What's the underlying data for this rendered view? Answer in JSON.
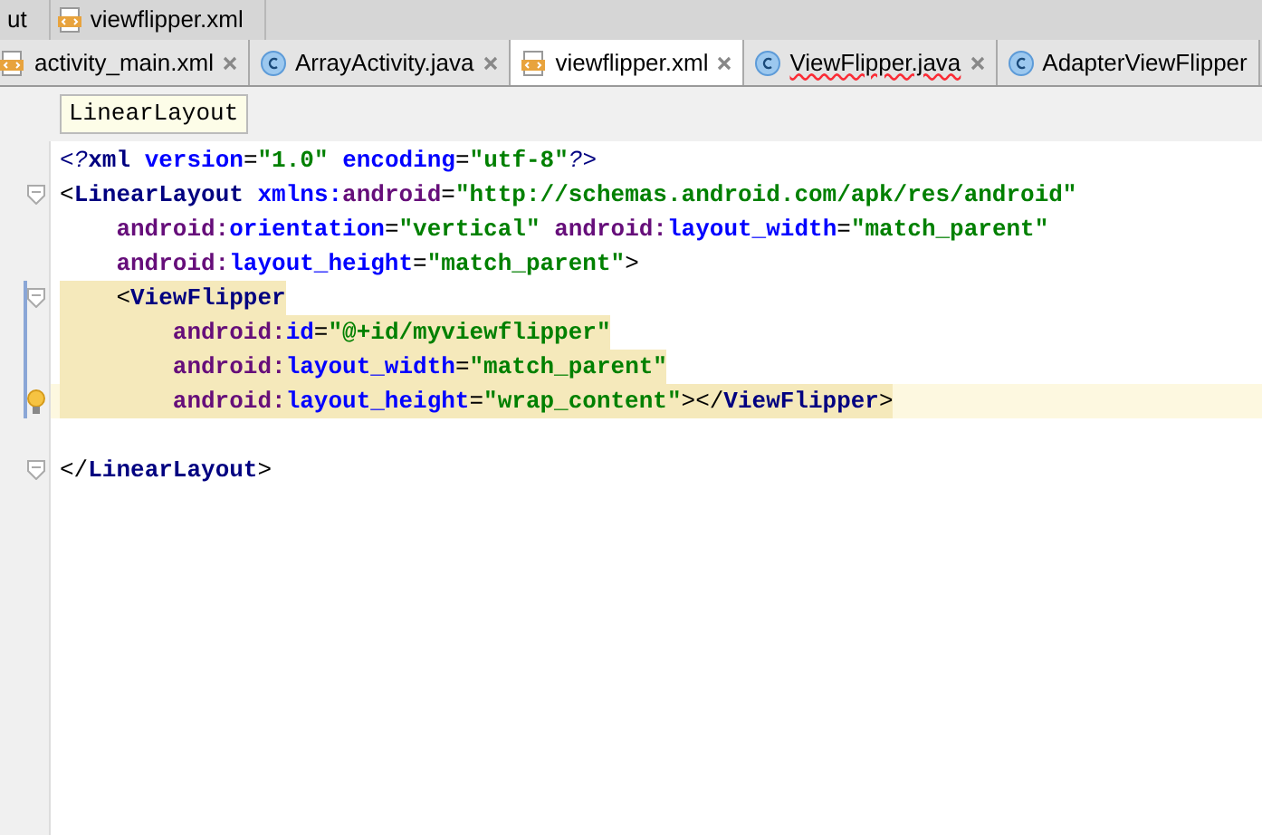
{
  "breadcrumbs": [
    "ut",
    "viewflipper.xml"
  ],
  "tabs": [
    {
      "label": "activity_main.xml",
      "kind": "xml",
      "selected": false,
      "error": false
    },
    {
      "label": "ArrayActivity.java",
      "kind": "java",
      "selected": false,
      "error": false
    },
    {
      "label": "viewflipper.xml",
      "kind": "xml",
      "selected": true,
      "error": false
    },
    {
      "label": "ViewFlipper.java",
      "kind": "java",
      "selected": false,
      "error": true
    },
    {
      "label": "AdapterViewFlipper",
      "kind": "java",
      "selected": false,
      "error": false
    }
  ],
  "tooltip": "LinearLayout",
  "lines": [
    {
      "highlighted": false,
      "current": false,
      "tokens": [
        {
          "kind": "pi",
          "text": "<?"
        },
        {
          "kind": "tag",
          "text": "xml "
        },
        {
          "kind": "attr",
          "text": "version"
        },
        {
          "kind": "punct",
          "text": "="
        },
        {
          "kind": "value",
          "text": "\"1.0\" "
        },
        {
          "kind": "attr",
          "text": "encoding"
        },
        {
          "kind": "punct",
          "text": "="
        },
        {
          "kind": "value",
          "text": "\"utf-8\""
        },
        {
          "kind": "pi",
          "text": "?>"
        }
      ]
    },
    {
      "highlighted": false,
      "current": false,
      "gutter": {
        "kind": "fold"
      },
      "tokens": [
        {
          "kind": "punct",
          "text": "<"
        },
        {
          "kind": "tag",
          "text": "LinearLayout "
        },
        {
          "kind": "attr",
          "text": "xmlns:"
        },
        {
          "kind": "ns",
          "text": "android"
        },
        {
          "kind": "punct",
          "text": "="
        },
        {
          "kind": "value",
          "text": "\"http://schemas.android.com/apk/res/android\""
        }
      ],
      "children": [
        {
          "highlighted": false,
          "current": false,
          "tokens": [
            {
              "kind": "ns",
              "text": "android:"
            },
            {
              "kind": "attr",
              "text": "orientation"
            },
            {
              "kind": "punct",
              "text": "="
            },
            {
              "kind": "value",
              "text": "\"vertical\" "
            },
            {
              "kind": "ns",
              "text": "android:"
            },
            {
              "kind": "attr",
              "text": "layout_width"
            },
            {
              "kind": "punct",
              "text": "="
            },
            {
              "kind": "value",
              "text": "\"match_parent\""
            }
          ]
        },
        {
          "highlighted": false,
          "current": false,
          "tokens": [
            {
              "kind": "ns",
              "text": "android:"
            },
            {
              "kind": "attr",
              "text": "layout_height"
            },
            {
              "kind": "punct",
              "text": "="
            },
            {
              "kind": "value",
              "text": "\"match_parent\""
            },
            {
              "kind": "punct",
              "text": ">"
            }
          ]
        },
        {
          "highlighted": true,
          "current": false,
          "gutter": {
            "kind": "fold"
          },
          "tokens": [
            {
              "kind": "punct",
              "text": "<"
            },
            {
              "kind": "tag",
              "text": "ViewFlipper"
            }
          ],
          "children": [
            {
              "highlighted": true,
              "current": false,
              "tokens": [
                {
                  "kind": "ns",
                  "text": "android:"
                },
                {
                  "kind": "attr",
                  "text": "id"
                },
                {
                  "kind": "punct",
                  "text": "="
                },
                {
                  "kind": "value",
                  "text": "\"@+id/myviewflipper\""
                }
              ]
            },
            {
              "highlighted": true,
              "current": false,
              "tokens": [
                {
                  "kind": "ns",
                  "text": "android:"
                },
                {
                  "kind": "attr",
                  "text": "layout_width"
                },
                {
                  "kind": "punct",
                  "text": "="
                },
                {
                  "kind": "value",
                  "text": "\"match_parent\""
                }
              ]
            },
            {
              "highlighted": true,
              "current": true,
              "gutter": {
                "kind": "bulb"
              },
              "tokens": [
                {
                  "kind": "ns",
                  "text": "android:"
                },
                {
                  "kind": "attr",
                  "text": "layout_height"
                },
                {
                  "kind": "punct",
                  "text": "="
                },
                {
                  "kind": "value",
                  "text": "\"wrap_content\""
                },
                {
                  "kind": "punct",
                  "text": "></"
                },
                {
                  "kind": "tag",
                  "text": "ViewFlipper"
                },
                {
                  "kind": "punct",
                  "text": ">"
                }
              ]
            }
          ]
        }
      ]
    },
    {
      "highlighted": false,
      "current": false,
      "gap_before": true,
      "gutter": {
        "kind": "fold"
      },
      "tokens": [
        {
          "kind": "punct",
          "text": "</"
        },
        {
          "kind": "tag",
          "text": "LinearLayout"
        },
        {
          "kind": "punct",
          "text": ">"
        }
      ]
    }
  ]
}
